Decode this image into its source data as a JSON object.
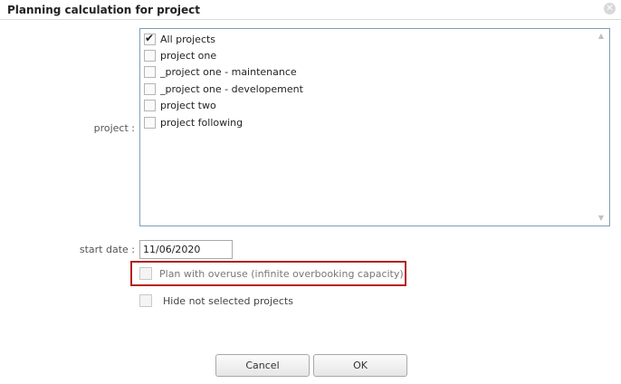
{
  "dialog": {
    "title": "Planning calculation for project",
    "close_icon": "close-circle-icon"
  },
  "form": {
    "project_label": "project :",
    "project_options": [
      {
        "label": "All projects",
        "checked": true
      },
      {
        "label": "project one",
        "checked": false
      },
      {
        "label": "_project one - maintenance",
        "checked": false
      },
      {
        "label": "_project one - developement",
        "checked": false
      },
      {
        "label": "project two",
        "checked": false
      },
      {
        "label": "project following",
        "checked": false
      }
    ],
    "start_date_label": "start date :",
    "start_date_value": "11/06/2020",
    "overuse_label": "Plan with overuse (infinite overbooking capacity)",
    "overuse_checked": false,
    "hide_label": "Hide not selected projects",
    "hide_checked": false
  },
  "buttons": {
    "cancel": "Cancel",
    "ok": "OK"
  },
  "colors": {
    "highlight_border": "#b52020",
    "listbox_border": "#7f9db9"
  }
}
